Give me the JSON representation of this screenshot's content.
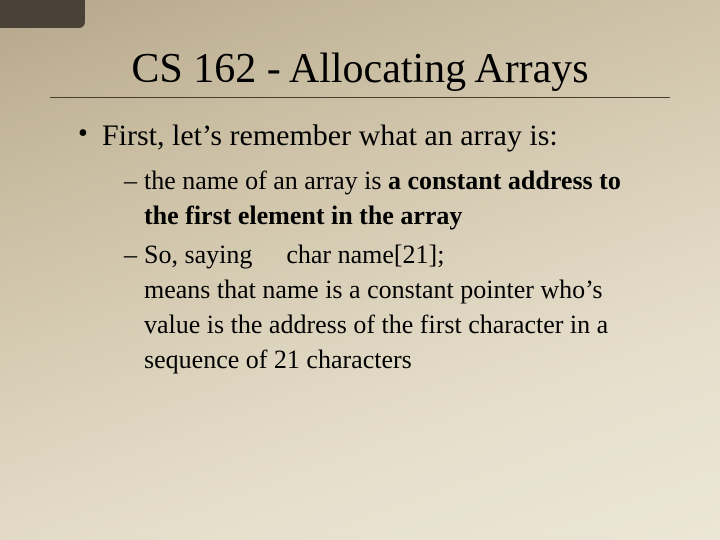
{
  "title": "CS 162 - Allocating Arrays",
  "bullet1": "First, let’s remember what an array is:",
  "sub1_pre": "the name of an array is ",
  "sub1_bold": "a constant address to the first element in the array",
  "sub2_pre": "So, saying",
  "sub2_code": "char name[21];",
  "sub2_rest": "means that name is a constant pointer who’s value is the address of the first character in a sequence of 21 characters"
}
